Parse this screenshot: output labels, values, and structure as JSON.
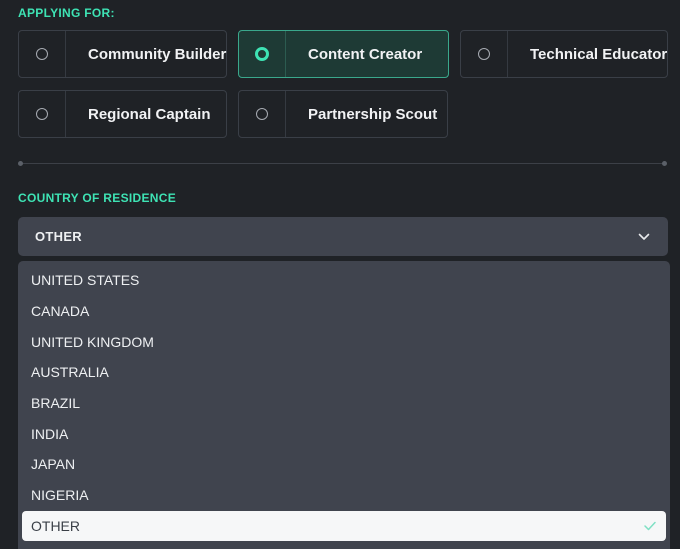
{
  "applying_for": {
    "label": "APPLYING FOR:",
    "options": [
      {
        "label": "Community Builder",
        "selected": false
      },
      {
        "label": "Content Creator",
        "selected": true
      },
      {
        "label": "Technical Educator",
        "selected": false
      },
      {
        "label": "Regional Captain",
        "selected": false
      },
      {
        "label": "Partnership Scout",
        "selected": false
      }
    ]
  },
  "country": {
    "label": "COUNTRY OF RESIDENCE",
    "selected_value": "OTHER",
    "options": [
      "UNITED STATES",
      "CANADA",
      "UNITED KINGDOM",
      "AUSTRALIA",
      "BRAZIL",
      "INDIA",
      "JAPAN",
      "NIGERIA",
      "OTHER"
    ]
  },
  "colors": {
    "accent": "#3ee3b4",
    "background": "#1f2226",
    "selected_option_bg": "#1e3a35",
    "dropdown_bg": "#40444e",
    "dropdown_selected_bg": "#f6f7f8"
  },
  "icons": {
    "select_arrow": "chevron-down-icon",
    "selected_mark": "check-icon"
  }
}
